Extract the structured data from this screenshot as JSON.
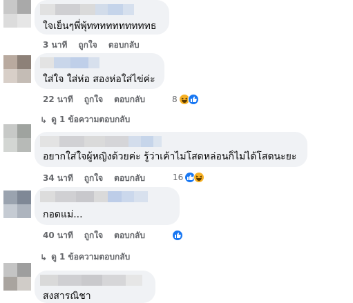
{
  "comments": [
    {
      "text": "ใจเย็นๆพี่พุ้ททททททททททธ",
      "time": "3 นาที",
      "like": "ถูกใจ",
      "reply": "ตอบกลับ"
    },
    {
      "text": "ใส่ใจ ใส่ห่อ สองห่อใส่ไข่ค่ะ",
      "time": "22 นาที",
      "like": "ถูกใจ",
      "reply": "ตอบกลับ",
      "reaction_count": "8",
      "view_replies": "ดู 1 ข้อความตอบกลับ"
    },
    {
      "text": "อยากใส่ใจผู้หญิงด้วยค่ะ รู้ว่าเค้าไม่โสดหล่อนก็ไม่ได้โสดนะยะ",
      "time": "34 นาที",
      "like": "ถูกใจ",
      "reply": "ตอบกลับ",
      "reaction_count": "16"
    },
    {
      "text": "กอดแม่...",
      "time": "40 นาที",
      "like": "ถูกใจ",
      "reply": "ตอบกลับ",
      "view_replies": "ดู 1 ข้อความตอบกลับ"
    },
    {
      "text": "สงสารณิชา"
    }
  ],
  "colors": {
    "bubble": "#f0f2f5",
    "meta": "#65676b",
    "like_blue": "#1877f2",
    "haha_yellow": "#f7b125"
  },
  "icons": {
    "like": "thumbs-up-icon",
    "haha": "laughing-face-icon"
  }
}
